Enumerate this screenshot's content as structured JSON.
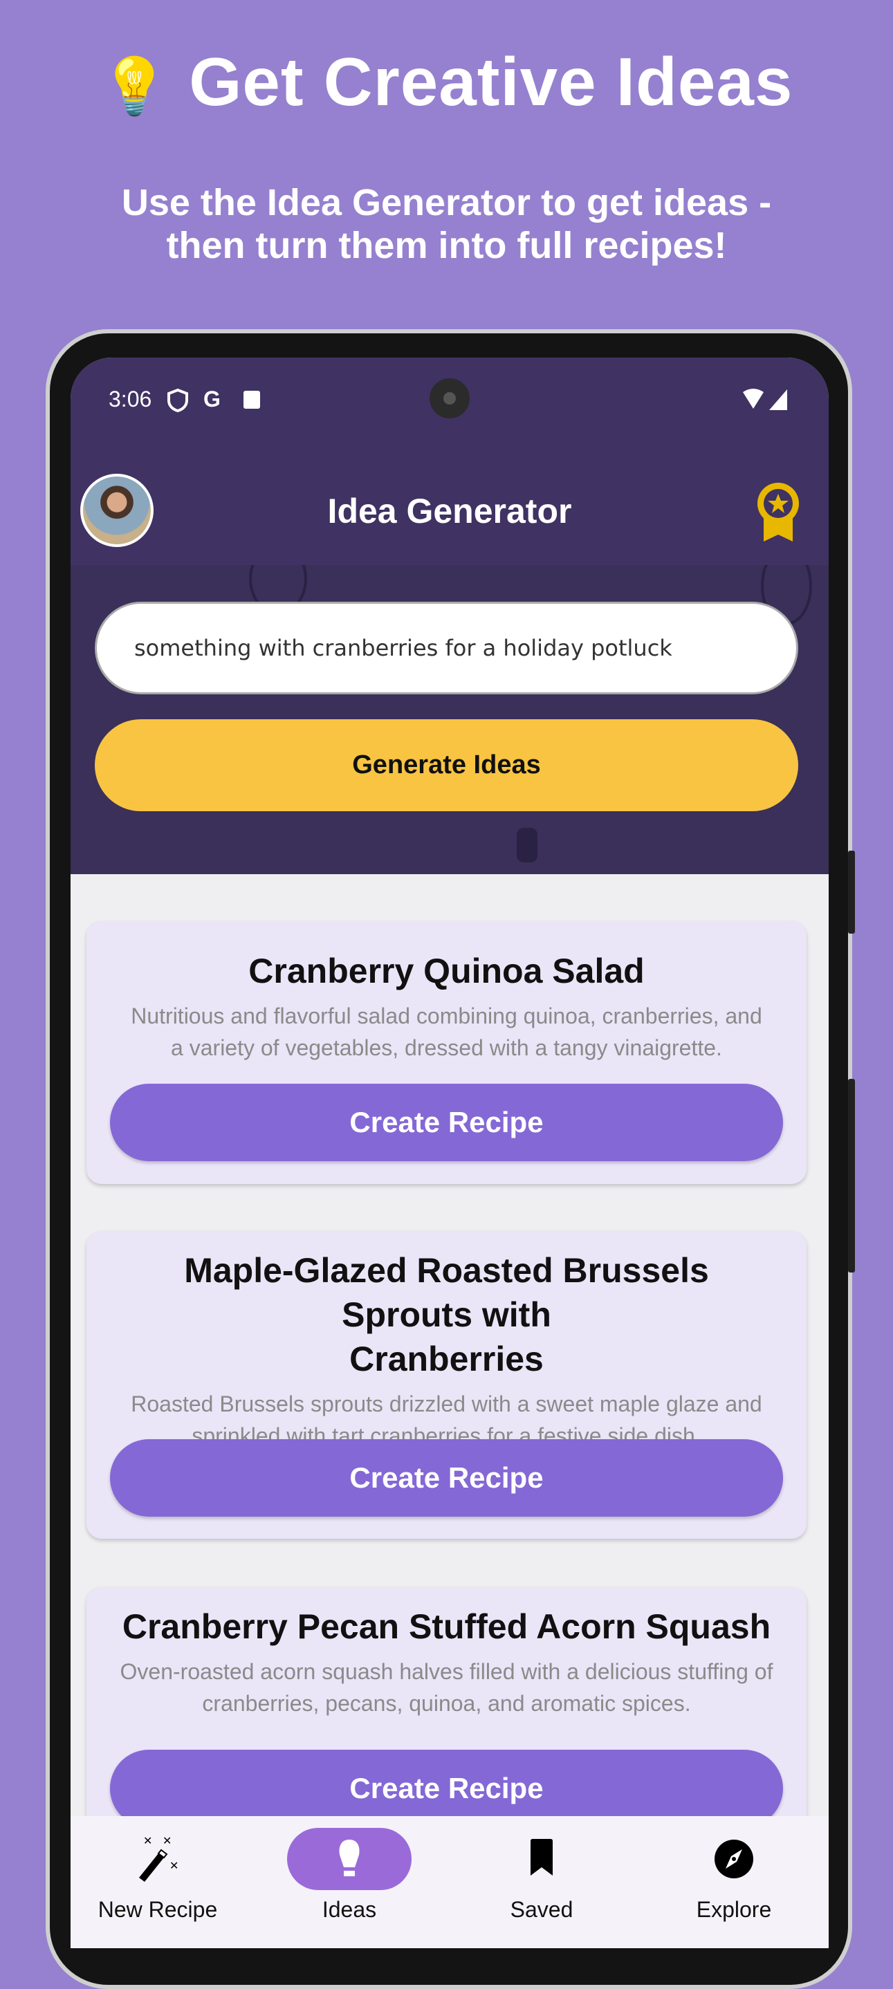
{
  "promo": {
    "title": "Get Creative Ideas",
    "title_icon": "lightbulb-emoji",
    "subtitle_line1": "Use the Idea Generator to get ideas -",
    "subtitle_line2": "then turn them into full recipes!"
  },
  "status_bar": {
    "time": "3:06"
  },
  "app_bar": {
    "title": "Idea Generator",
    "right_icon": "award-badge-icon"
  },
  "search": {
    "value": "something with cranberries for a holiday potluck"
  },
  "generate_label": "Generate Ideas",
  "ideas": [
    {
      "title": "Cranberry Quinoa Salad",
      "desc_line1": "Nutritious and flavorful salad combining quinoa, cranberries, and",
      "desc_line2": "a variety of vegetables, dressed with a tangy vinaigrette.",
      "button": "Create Recipe"
    },
    {
      "title_line1": "Maple-Glazed Roasted Brussels Sprouts with",
      "title_line2": "Cranberries",
      "desc_line1": "Roasted Brussels sprouts drizzled with a sweet maple glaze and",
      "desc_line2": "sprinkled with tart cranberries for a festive side dish.",
      "button": "Create Recipe"
    },
    {
      "title": "Cranberry Pecan Stuffed Acorn Squash",
      "desc_line1": "Oven-roasted acorn squash halves filled with a delicious stuffing of",
      "desc_line2": "cranberries, pecans, quinoa, and aromatic spices.",
      "button": "Create Recipe"
    }
  ],
  "nav": [
    {
      "label": "New Recipe",
      "icon": "magic-wand-icon"
    },
    {
      "label": "Ideas",
      "icon": "lightbulb-icon",
      "active": true
    },
    {
      "label": "Saved",
      "icon": "bookmark-icon"
    },
    {
      "label": "Explore",
      "icon": "compass-icon"
    }
  ],
  "colors": {
    "background": "#9581cf",
    "header": "#403263",
    "generate": "#f8c442",
    "create": "#8468d6",
    "card": "#ebe5f8",
    "nav_active": "#9a6ad9"
  }
}
